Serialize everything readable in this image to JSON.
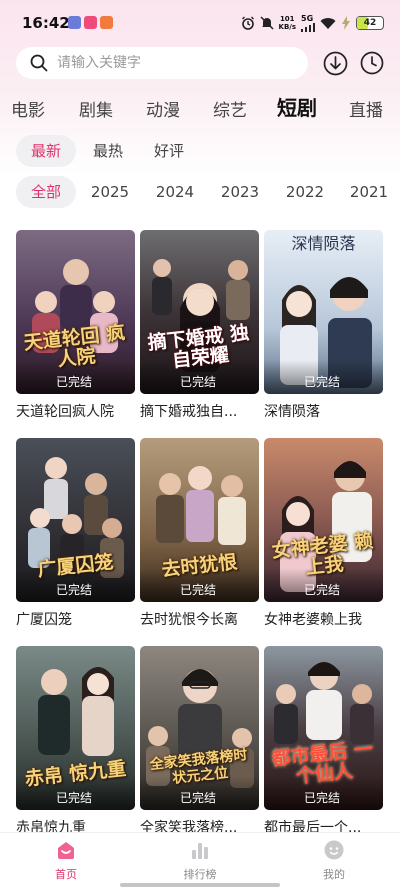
{
  "status_bar": {
    "time": "16:42",
    "net_speed_value": "101",
    "net_speed_unit": "KB/s",
    "network": "5G",
    "battery": "42"
  },
  "search": {
    "placeholder": "请输入关键字",
    "value": ""
  },
  "categories": [
    "电影",
    "剧集",
    "动漫",
    "综艺",
    "短剧",
    "直播"
  ],
  "active_category": "短剧",
  "sort_options": [
    "最新",
    "最热",
    "好评"
  ],
  "active_sort": "最新",
  "years": [
    "全部",
    "2025",
    "2024",
    "2023",
    "2022",
    "2021"
  ],
  "active_year": "全部",
  "items": [
    {
      "title": "天道轮回疯人院",
      "status": "已完结",
      "poster_text": "天道轮回 疯人院",
      "theme": "purple-gold"
    },
    {
      "title": "摘下婚戒独自...",
      "status": "已完结",
      "poster_text": "摘下婚戒 独自荣耀",
      "theme": "dark-room"
    },
    {
      "title": "深情陨落",
      "status": "已完结",
      "poster_text": "深情陨落",
      "theme": "light-blue"
    },
    {
      "title": "广厦囚笼",
      "status": "已完结",
      "poster_text": "广厦囚笼",
      "theme": "dark-brown"
    },
    {
      "title": "去时犹恨今长离",
      "status": "已完结",
      "poster_text": "去时犹恨",
      "theme": "palace"
    },
    {
      "title": "女神老婆赖上我",
      "status": "已完结",
      "poster_text": "女神老婆 赖上我",
      "theme": "sunset"
    },
    {
      "title": "赤帛惊九重",
      "status": "已完结",
      "poster_text": "赤帛 惊九重",
      "theme": "teal-gold"
    },
    {
      "title": "全家笑我落榜...",
      "status": "已完结",
      "poster_text": "全家笑我落榜时 状元之位",
      "theme": "gray-gold"
    },
    {
      "title": "都市最后一个...",
      "status": "已完结",
      "poster_text": "都市最后 一个仙人",
      "theme": "red-dark"
    }
  ],
  "bottom_nav": [
    {
      "label": "首页",
      "icon": "home-icon",
      "active": true
    },
    {
      "label": "排行榜",
      "icon": "ranking-icon",
      "active": false
    },
    {
      "label": "我的",
      "icon": "profile-icon",
      "active": false
    }
  ],
  "colors": {
    "accent": "#e0336d",
    "header_gradient_top": "#fbe4ee"
  }
}
